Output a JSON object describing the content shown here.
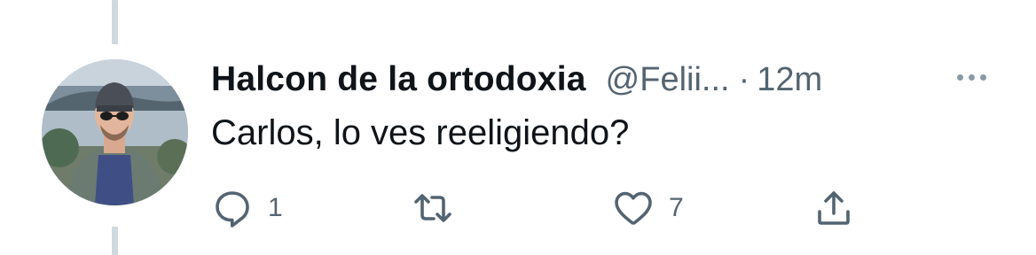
{
  "tweet": {
    "display_name": "Halcon de la ortodoxia",
    "handle": "@Felii...",
    "separator": "·",
    "time": "12m",
    "text": "Carlos, lo ves reeligiendo?"
  },
  "actions": {
    "reply": {
      "icon": "reply-icon",
      "count": "1"
    },
    "retweet": {
      "icon": "retweet-icon",
      "count": ""
    },
    "like": {
      "icon": "heart-icon",
      "count": "7"
    },
    "share": {
      "icon": "share-icon"
    }
  },
  "colors": {
    "text_primary": "#0f1419",
    "text_secondary": "#536471",
    "thread_line": "#cfd9de"
  }
}
